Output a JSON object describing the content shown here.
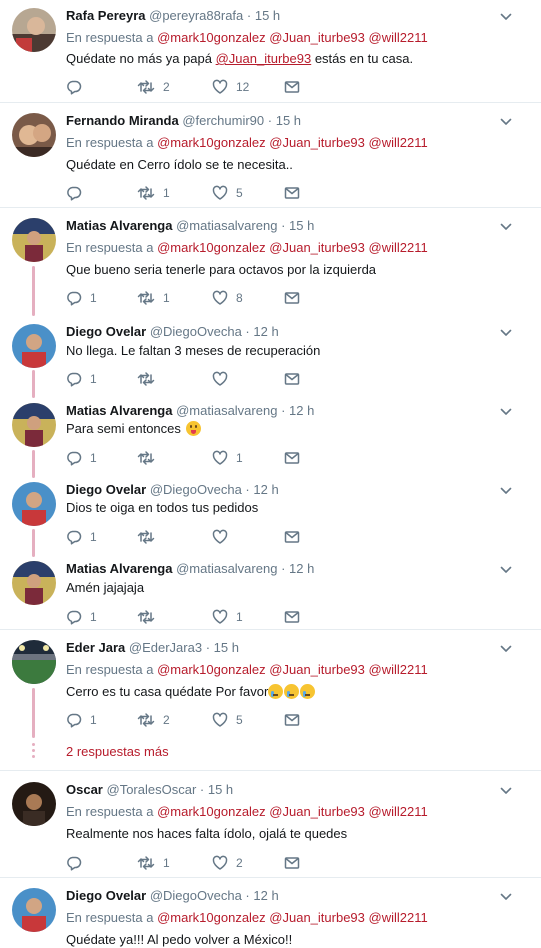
{
  "labels": {
    "reply_prefix": "En respuesta a"
  },
  "tweets": [
    {
      "name": "Rafa Pereyra",
      "handle": "@pereyra88rafa",
      "time": "15 h",
      "reply_to": [
        "@mark10gonzalez",
        "@Juan_iturbe93",
        "@will2211"
      ],
      "text_before": "Quédate no más ya papá ",
      "text_mention": "@Juan_iturbe93",
      "text_after": " estás en tu casa.",
      "replies": "",
      "retweets": "2",
      "likes": "12"
    },
    {
      "name": "Fernando Miranda",
      "handle": "@ferchumir90",
      "time": "15 h",
      "reply_to": [
        "@mark10gonzalez",
        "@Juan_iturbe93",
        "@will2211"
      ],
      "text": "Quédate en Cerro ídolo se te necesita..",
      "replies": "",
      "retweets": "1",
      "likes": "5"
    },
    {
      "name": "Matias Alvarenga",
      "handle": "@matiasalvareng",
      "time": "15 h",
      "reply_to": [
        "@mark10gonzalez",
        "@Juan_iturbe93",
        "@will2211"
      ],
      "text": "Que bueno seria tenerle para octavos por la izquierda",
      "replies": "1",
      "retweets": "1",
      "likes": "8"
    },
    {
      "name": "Diego Ovelar",
      "handle": "@DiegoOvecha",
      "time": "12 h",
      "text": "No llega. Le faltan 3 meses de recuperación",
      "replies": "1",
      "retweets": "",
      "likes": ""
    },
    {
      "name": "Matias Alvarenga",
      "handle": "@matiasalvareng",
      "time": "12 h",
      "text": "Para semi entonces",
      "emoji": "tongue-face",
      "replies": "1",
      "retweets": "",
      "likes": "1"
    },
    {
      "name": "Diego Ovelar",
      "handle": "@DiegoOvecha",
      "time": "12 h",
      "text": "Dios te oiga en todos tus pedidos",
      "replies": "1",
      "retweets": "",
      "likes": ""
    },
    {
      "name": "Matias Alvarenga",
      "handle": "@matiasalvareng",
      "time": "12 h",
      "text": "Amén jajajaja",
      "replies": "1",
      "retweets": "",
      "likes": "1"
    },
    {
      "name": "Eder Jara",
      "handle": "@EderJara3",
      "time": "15 h",
      "reply_to": [
        "@mark10gonzalez",
        "@Juan_iturbe93",
        "@will2211"
      ],
      "text": "Cerro es tu casa quédate Por favor",
      "emoji": "crying-face x3",
      "replies": "1",
      "retweets": "2",
      "likes": "5",
      "more_replies": "2 respuestas más"
    },
    {
      "name": "Oscar",
      "handle": "@ToralesOscar",
      "time": "15 h",
      "reply_to": [
        "@mark10gonzalez",
        "@Juan_iturbe93",
        "@will2211"
      ],
      "text": "Realmente nos haces falta ídolo, ojalá te quedes",
      "replies": "",
      "retweets": "1",
      "likes": "2"
    },
    {
      "name": "Diego Ovelar",
      "handle": "@DiegoOvecha",
      "time": "12 h",
      "reply_to": [
        "@mark10gonzalez",
        "@Juan_iturbe93",
        "@will2211"
      ],
      "text": "Quédate ya!!! Al pedo volver a México!!"
    }
  ],
  "colors": {
    "accent": "#b71c2c",
    "thread_line": "#e5afc0",
    "muted": "#657786",
    "separator": "#e6ecf0"
  }
}
